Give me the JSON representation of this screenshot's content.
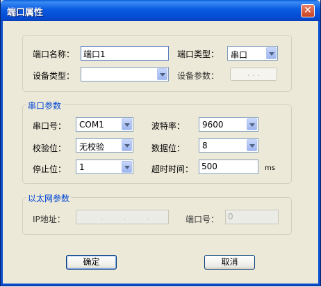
{
  "window": {
    "title": "端口属性",
    "close_icon": "close-icon"
  },
  "general": {
    "port_name_label": "端口名称：",
    "port_name_value": "端口1",
    "port_type_label": "端口类型：",
    "port_type_value": "串口",
    "device_type_label": "设备类型：",
    "device_type_value": "",
    "device_param_label": "设备参数：",
    "device_param_button": ". . ."
  },
  "serial": {
    "group_title": "串口参数",
    "com_label": "串口号：",
    "com_value": "COM1",
    "baud_label": "波特率：",
    "baud_value": "9600",
    "parity_label": "校验位：",
    "parity_value": "无校验",
    "databits_label": "数据位：",
    "databits_value": "8",
    "stopbits_label": "停止位：",
    "stopbits_value": "1",
    "timeout_label": "超时时间：",
    "timeout_value": "500",
    "timeout_unit": "ms"
  },
  "ethernet": {
    "group_title": "以太网参数",
    "ip_label": "IP地址：",
    "port_label": "端口号：",
    "port_value": "0"
  },
  "buttons": {
    "ok": "确定",
    "cancel": "取消"
  },
  "colors": {
    "titlebar": "#0a5be0",
    "group_title": "#0046d5",
    "dialog_bg": "#ece9d8"
  }
}
